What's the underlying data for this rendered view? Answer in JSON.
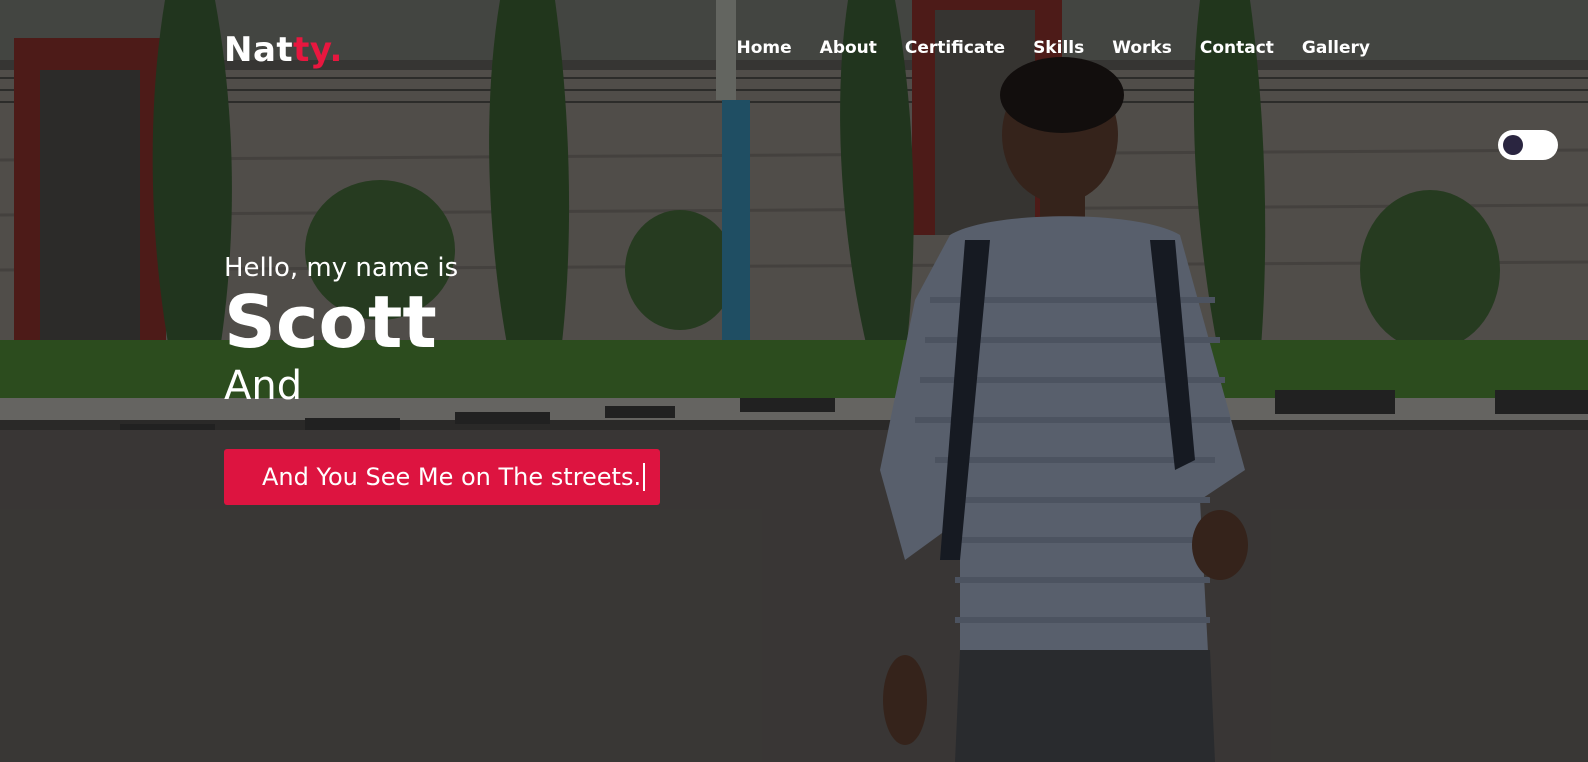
{
  "brand": {
    "part1": "Nat",
    "part2": "ty",
    "dot": "."
  },
  "nav": {
    "items": [
      {
        "label": "Home"
      },
      {
        "label": "About"
      },
      {
        "label": "Certificate"
      },
      {
        "label": "Skills"
      },
      {
        "label": "Works"
      },
      {
        "label": "Contact"
      },
      {
        "label": "Gallery"
      }
    ]
  },
  "hero": {
    "greeting": "Hello, my name is",
    "name": "Scott",
    "sub": "And",
    "cta": "And You See Me on The streets."
  },
  "colors": {
    "accent": "#e8173f",
    "button": "#dd1440",
    "text": "#ffffff"
  },
  "icons": {
    "theme_toggle": "toggle-switch"
  }
}
